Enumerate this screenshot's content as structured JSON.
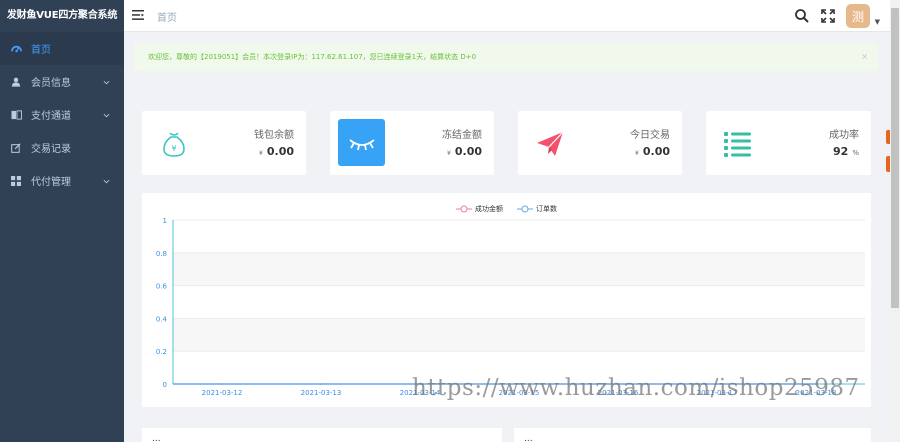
{
  "app": {
    "title": "发财鱼VUE四方聚合系统"
  },
  "sidebar": {
    "items": [
      {
        "label": "首页",
        "icon": "dashboard-icon",
        "active": true,
        "has_children": false
      },
      {
        "label": "会员信息",
        "icon": "user-icon",
        "active": false,
        "has_children": true
      },
      {
        "label": "支付通道",
        "icon": "channel-icon",
        "active": false,
        "has_children": true
      },
      {
        "label": "交易记录",
        "icon": "edit-icon",
        "active": false,
        "has_children": false
      },
      {
        "label": "代付管理",
        "icon": "grid-icon",
        "active": false,
        "has_children": true
      }
    ]
  },
  "header": {
    "breadcrumb": "首页",
    "avatar_text": "测",
    "avatar_color": "#e6b98a"
  },
  "alert": {
    "text": "欢迎您，尊敬的【2019051】会员！本次登录IP为：117.62.61.107，您已连续登录1天，结算状态 D+0",
    "close": "×"
  },
  "stats": [
    {
      "label": "钱包余额",
      "prefix": "¥",
      "value": "0.00",
      "suffix": "",
      "icon": "money-bag-icon",
      "color": "#36c5c5"
    },
    {
      "label": "冻结金额",
      "prefix": "¥",
      "value": "0.00",
      "suffix": "",
      "icon": "closed-eye-icon",
      "color": "#36a3f7"
    },
    {
      "label": "今日交易",
      "prefix": "¥",
      "value": "0.00",
      "suffix": "",
      "icon": "paper-plane-icon",
      "color": "#f4516c"
    },
    {
      "label": "成功率",
      "prefix": "",
      "value": "92",
      "suffix": "%",
      "icon": "list-icon",
      "color": "#34bfa3"
    }
  ],
  "chart_data": {
    "type": "line",
    "categories": [
      "2021-03-12",
      "2021-03-13",
      "2021-03-14",
      "2021-03-15",
      "2021-03-16",
      "2021-03-17",
      "2021-03-18"
    ],
    "ylim": [
      0,
      1
    ],
    "yticks": [
      "0",
      "0.2",
      "0.4",
      "0.6",
      "0.8",
      "1"
    ],
    "grid": true,
    "legend_position": "top-center",
    "series": [
      {
        "name": "成功金额",
        "values": [
          0,
          0,
          0,
          0,
          0,
          0,
          0
        ],
        "color": "#e6848f"
      },
      {
        "name": "订单数",
        "values": [
          0,
          0,
          0,
          0,
          0,
          0,
          0
        ],
        "color": "#6aa6e8"
      }
    ]
  },
  "bottom_panels": [
    {
      "title": "..."
    },
    {
      "title": "..."
    }
  ],
  "watermark": "https://www.huzhan.com/ishop25987"
}
